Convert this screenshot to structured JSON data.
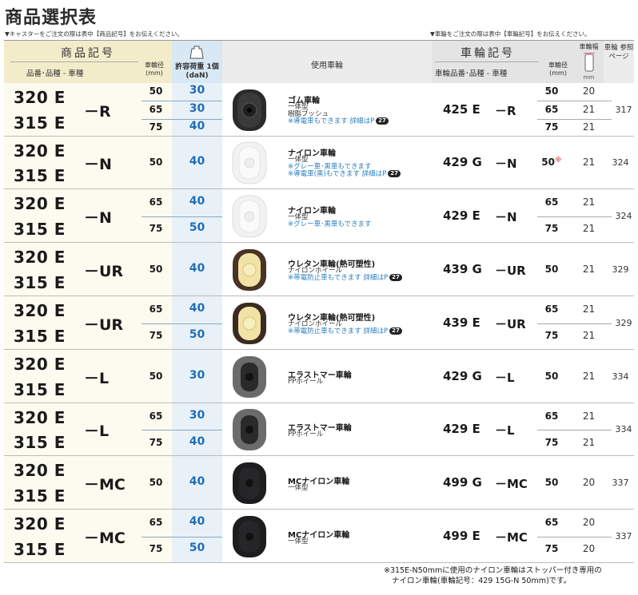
{
  "title": "商品選択表",
  "note_left": "▼キャスターをご注文の際は表中【商品記号】をお伝えください。",
  "note_right": "▼車輪をご注文の際は表中【車輪記号】をお伝えください。",
  "header": {
    "product_code": "商品記号",
    "part_number": "品番･品種 - 車種",
    "wheel_dia": "車輪径 (mm)",
    "load": "許容荷重 1個(daN)",
    "wheel_used": "使用車輪",
    "wheel_code": "車輪記号",
    "wheel_part": "車輪品番･品種 - 車種",
    "wheel_dia2": "車輪径 (mm)",
    "wheel_width": "車輪幅",
    "mm": "mm",
    "page_ref": "車輪 参照 ページ"
  },
  "rows": [
    {
      "models": [
        "320 E",
        "315 E"
      ],
      "suffix": "－R",
      "sizes": [
        {
          "dia": "50",
          "load": "30"
        },
        {
          "dia": "65",
          "load": "30"
        },
        {
          "dia": "75",
          "load": "40"
        }
      ],
      "wheel_name": "ゴム車輪",
      "wheel_desc": [
        "一体型",
        "樹脂ブッシュ"
      ],
      "wheel_notes": [
        "※導電車もできます 詳細はP"
      ],
      "badge": "27",
      "wheel_code": "425 E",
      "wheel_suffix": "－R",
      "rsizes": [
        {
          "dia": "50",
          "width": "20"
        },
        {
          "dia": "65",
          "width": "21"
        },
        {
          "dia": "75",
          "width": "21"
        }
      ],
      "page": "317",
      "wheel_style": "rubber"
    },
    {
      "models": [
        "320 E",
        "315 E"
      ],
      "suffix": "－N",
      "sizes": [
        {
          "dia": "50",
          "load": "40"
        }
      ],
      "wheel_name": "ナイロン車輪",
      "wheel_desc": [
        "一体型"
      ],
      "wheel_notes": [
        "※グレー車･黒車もできます",
        "※導電車(黒)もできます 詳細はP"
      ],
      "badge": "27",
      "wheel_code": "429 G",
      "wheel_suffix": "－N",
      "rsizes": [
        {
          "dia": "50",
          "width": "21",
          "mark": "※"
        }
      ],
      "page": "324",
      "wheel_style": "nylon"
    },
    {
      "models": [
        "320 E",
        "315 E"
      ],
      "suffix": "－N",
      "sizes": [
        {
          "dia": "65",
          "load": "40"
        },
        {
          "dia": "75",
          "load": "50"
        }
      ],
      "wheel_name": "ナイロン車輪",
      "wheel_desc": [
        "一体型"
      ],
      "wheel_notes": [
        "※グレー車･黒車もできます"
      ],
      "badge": "",
      "wheel_code": "429 E",
      "wheel_suffix": "－N",
      "rsizes": [
        {
          "dia": "65",
          "width": "21"
        },
        {
          "dia": "75",
          "width": "21"
        }
      ],
      "page": "324",
      "wheel_style": "nylon"
    },
    {
      "models": [
        "320 E",
        "315 E"
      ],
      "suffix": "－UR",
      "sizes": [
        {
          "dia": "50",
          "load": "40"
        }
      ],
      "wheel_name": "ウレタン車輪(熱可塑性)",
      "wheel_desc": [
        "ナイロンホイール"
      ],
      "wheel_notes": [
        "※帯電防止車もできます 詳細はP"
      ],
      "badge": "27",
      "wheel_code": "439 G",
      "wheel_suffix": "－UR",
      "rsizes": [
        {
          "dia": "50",
          "width": "21"
        }
      ],
      "page": "329",
      "wheel_style": "urethane"
    },
    {
      "models": [
        "320 E",
        "315 E"
      ],
      "suffix": "－UR",
      "sizes": [
        {
          "dia": "65",
          "load": "40"
        },
        {
          "dia": "75",
          "load": "50"
        }
      ],
      "wheel_name": "ウレタン車輪(熱可塑性)",
      "wheel_desc": [
        "ナイロンホイール"
      ],
      "wheel_notes": [
        "※帯電防止車もできます 詳細はP"
      ],
      "badge": "27",
      "wheel_code": "439 E",
      "wheel_suffix": "－UR",
      "rsizes": [
        {
          "dia": "65",
          "width": "21"
        },
        {
          "dia": "75",
          "width": "21"
        }
      ],
      "page": "329",
      "wheel_style": "urethane2"
    },
    {
      "models": [
        "320 E",
        "315 E"
      ],
      "suffix": "－L",
      "sizes": [
        {
          "dia": "50",
          "load": "30"
        }
      ],
      "wheel_name": "エラストマー車輪",
      "wheel_desc": [
        "PPホイール"
      ],
      "wheel_notes": [],
      "badge": "",
      "wheel_code": "429 G",
      "wheel_suffix": "－L",
      "rsizes": [
        {
          "dia": "50",
          "width": "21"
        }
      ],
      "page": "334",
      "wheel_style": "elastomer"
    },
    {
      "models": [
        "320 E",
        "315 E"
      ],
      "suffix": "－L",
      "sizes": [
        {
          "dia": "65",
          "load": "30"
        },
        {
          "dia": "75",
          "load": "40"
        }
      ],
      "wheel_name": "エラストマー車輪",
      "wheel_desc": [
        "PPホイール"
      ],
      "wheel_notes": [],
      "badge": "",
      "wheel_code": "429 E",
      "wheel_suffix": "－L",
      "rsizes": [
        {
          "dia": "65",
          "width": "21"
        },
        {
          "dia": "75",
          "width": "21"
        }
      ],
      "page": "334",
      "wheel_style": "elastomer"
    },
    {
      "models": [
        "320 E",
        "315 E"
      ],
      "suffix": "－MC",
      "sizes": [
        {
          "dia": "50",
          "load": "40"
        }
      ],
      "wheel_name": "MCナイロン車輪",
      "wheel_desc": [
        "一体型"
      ],
      "wheel_notes": [],
      "badge": "",
      "wheel_code": "499 G",
      "wheel_suffix": "－MC",
      "rsizes": [
        {
          "dia": "50",
          "width": "20"
        }
      ],
      "page": "337",
      "wheel_style": "mc"
    },
    {
      "models": [
        "320 E",
        "315 E"
      ],
      "suffix": "－MC",
      "sizes": [
        {
          "dia": "65",
          "load": "40"
        },
        {
          "dia": "75",
          "load": "50"
        }
      ],
      "wheel_name": "MCナイロン車輪",
      "wheel_desc": [
        "一体型"
      ],
      "wheel_notes": [],
      "badge": "",
      "wheel_code": "499 E",
      "wheel_suffix": "－MC",
      "rsizes": [
        {
          "dia": "65",
          "width": "20"
        },
        {
          "dia": "75",
          "width": "20"
        }
      ],
      "page": "337",
      "wheel_style": "mc"
    }
  ],
  "footnote": [
    "※315E-N50mmに使用のナイロン車輪はストッパー付き専用の",
    "ナイロン車輪(車輪記号：429 15G-N 50mm)です。"
  ],
  "colors": {
    "load_blue": "#1f6fb5",
    "note_blue": "#2b7fc0",
    "asterisk": "#e0707a"
  }
}
